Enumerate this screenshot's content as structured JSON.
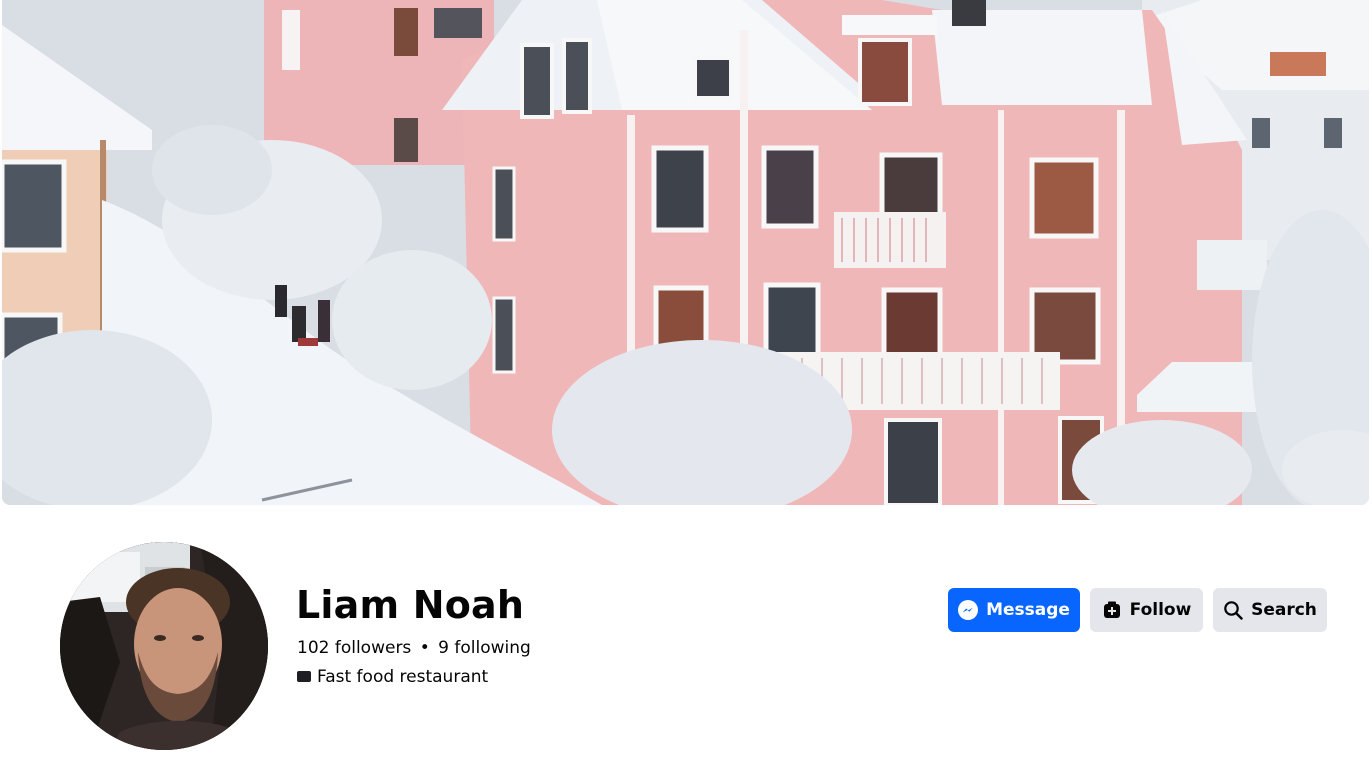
{
  "profile": {
    "name": "Liam Noah",
    "followers": "102 followers",
    "following": "9 following",
    "separator": "•",
    "category": "Fast food restaurant"
  },
  "actions": {
    "message_label": "Message",
    "follow_label": "Follow",
    "search_label": "Search"
  },
  "colors": {
    "primary": "#0866ff",
    "secondary_button": "#e4e6eb",
    "text": "#050505"
  },
  "icons": {
    "message": "messenger-icon",
    "follow": "add-friend-icon",
    "search": "search-icon",
    "category": "briefcase-icon"
  }
}
